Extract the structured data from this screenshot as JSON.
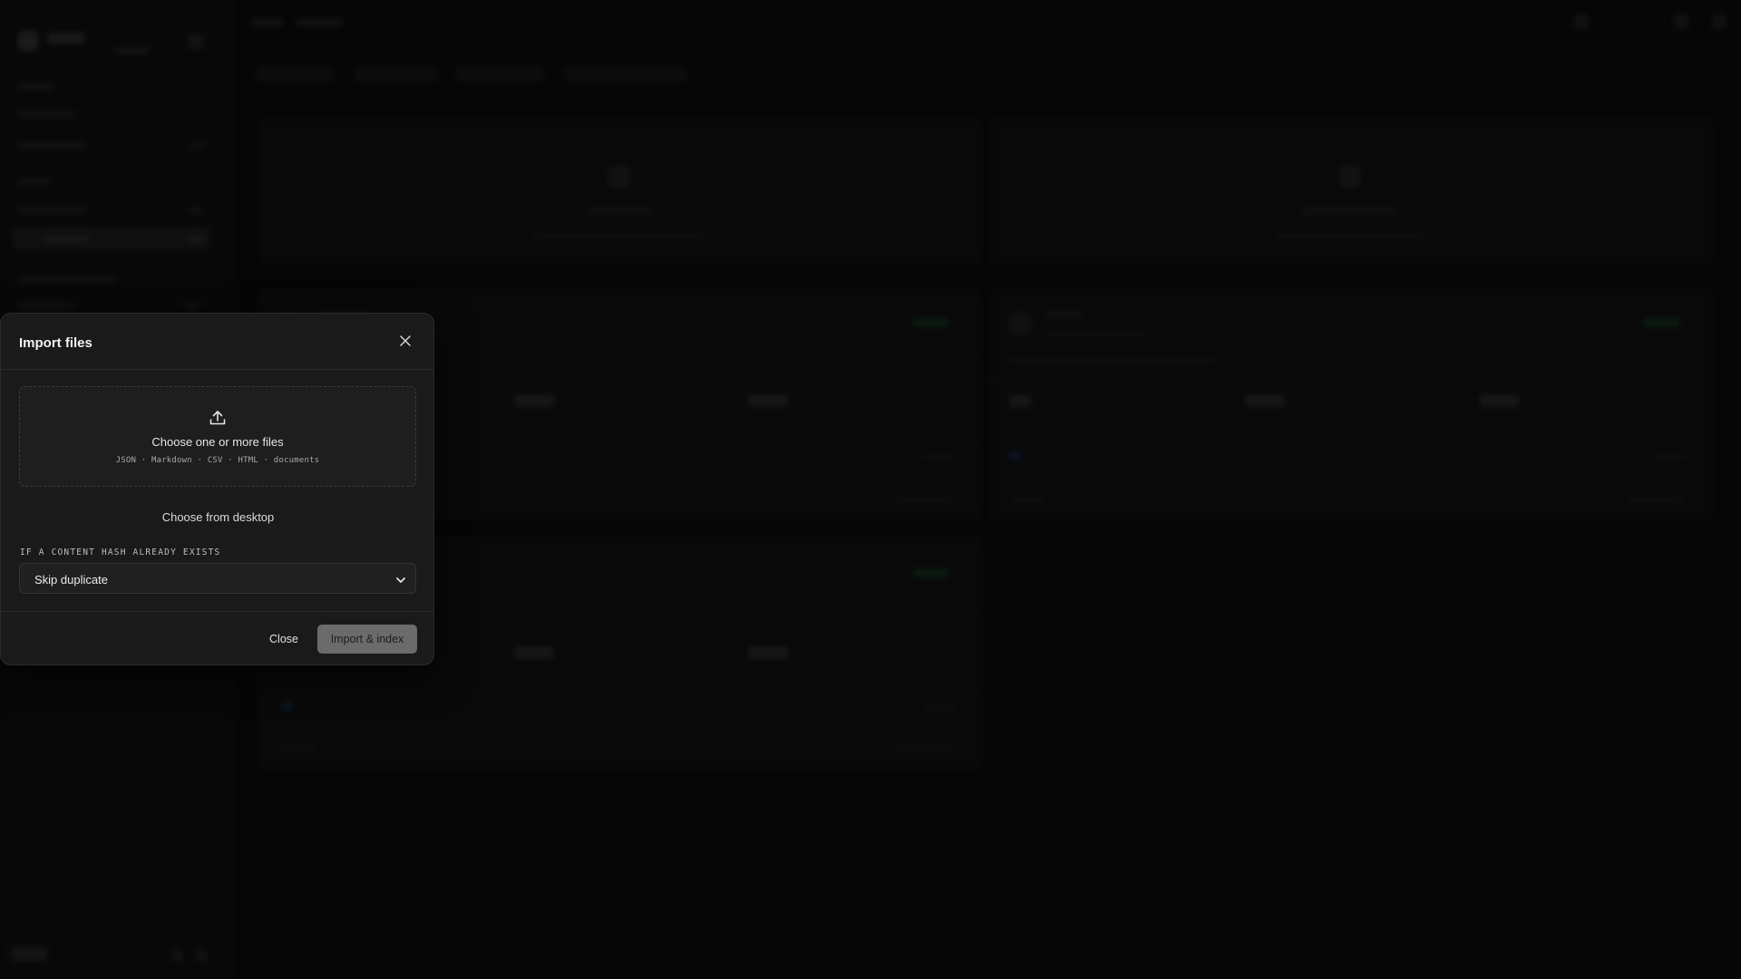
{
  "modal": {
    "title": "Import files",
    "dropzone": {
      "title": "Choose one or more files",
      "subtitle": "JSON · Markdown · CSV · HTML · documents"
    },
    "choose_from_desktop": "Choose from desktop",
    "duplicate_label": "If a content hash already exists",
    "duplicate_select": {
      "selected": "Skip duplicate"
    },
    "close_label": "Close",
    "import_label": "Import & index"
  },
  "icons": {
    "close": "close-icon",
    "upload": "upload-icon",
    "chevron": "chevron-down-icon"
  },
  "colors": {
    "modal_bg": "#1a1a1a",
    "primary_button": "#6b6b6b",
    "backdrop": "#0a0a0a"
  }
}
